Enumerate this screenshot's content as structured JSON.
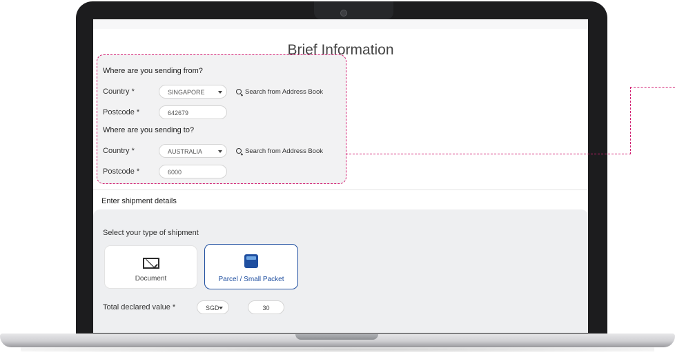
{
  "page": {
    "title": "Brief Information"
  },
  "origin": {
    "heading": "Where are you sending from?",
    "country_label": "Country *",
    "country_value": "SINGAPORE",
    "search_label": "Search from Address Book",
    "postcode_label": "Postcode *",
    "postcode_value": "642679"
  },
  "destination": {
    "heading": "Where are you sending to?",
    "country_label": "Country *",
    "country_value": "AUSTRALIA",
    "search_label": "Search from Address Book",
    "postcode_label": "Postcode *",
    "postcode_value": "6000"
  },
  "shipment": {
    "section_title": "Enter shipment details",
    "type_prompt": "Select your type of shipment",
    "types": [
      {
        "label": "Document",
        "icon": "envelope-icon",
        "selected": false
      },
      {
        "label": "Parcel / Small Packet",
        "icon": "parcel-box-icon",
        "selected": true
      }
    ],
    "declared_label": "Total declared value *",
    "currency": "SGD",
    "declared_value": "30"
  },
  "colors": {
    "highlight_dash": "#d21f72",
    "accent_blue": "#1f4fa0",
    "panel_grey": "#eeeff1"
  }
}
